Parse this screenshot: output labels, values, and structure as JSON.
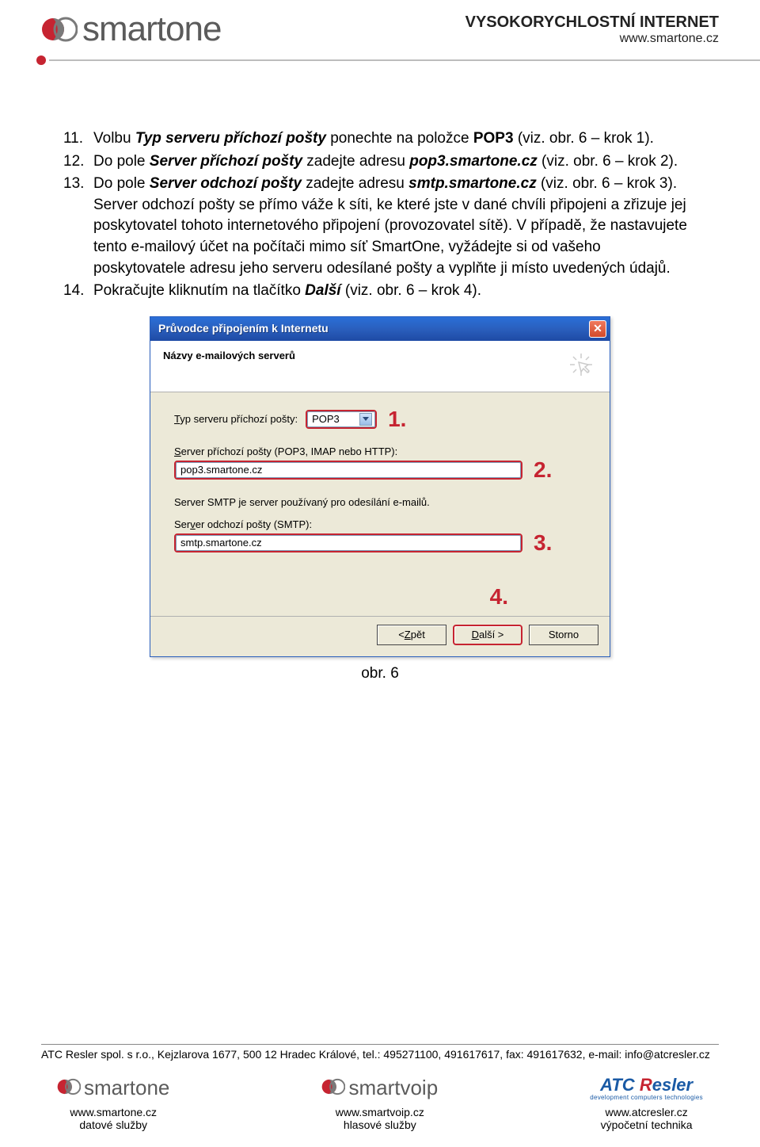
{
  "header": {
    "brand": "smartone",
    "right1": "VYSOKORYCHLOSTNÍ INTERNET",
    "right2": "www.smartone.cz"
  },
  "steps": [
    {
      "num": "11.",
      "parts": [
        {
          "t": "Volbu "
        },
        {
          "t": "Typ serveru příchozí pošty",
          "cls": "bi"
        },
        {
          "t": " ponechte na položce "
        },
        {
          "t": "POP3",
          "cls": "b"
        },
        {
          "t": " (viz. obr. 6 – krok 1)."
        }
      ]
    },
    {
      "num": "12.",
      "parts": [
        {
          "t": "Do pole "
        },
        {
          "t": "Server příchozí pošty",
          "cls": "bi"
        },
        {
          "t": " zadejte adresu "
        },
        {
          "t": "pop3.smartone.cz",
          "cls": "bi"
        },
        {
          "t": " (viz. obr. 6 – krok 2)."
        }
      ]
    },
    {
      "num": "13.",
      "parts": [
        {
          "t": "Do pole "
        },
        {
          "t": "Server odchozí pošty",
          "cls": "bi"
        },
        {
          "t": " zadejte adresu "
        },
        {
          "t": "smtp.smartone.cz",
          "cls": "bi"
        },
        {
          "t": " (viz. obr. 6 – krok 3). Server odchozí pošty se přímo váže k síti, ke které jste v dané chvíli připojeni a zřizuje jej poskytovatel tohoto internetového připojení (provozovatel sítě). V případě, že nastavujete tento e-mailový účet na počítači mimo síť SmartOne, vyžádejte si od vašeho poskytovatele adresu jeho serveru odesílané pošty a vyplňte ji místo uvedených údajů."
        }
      ]
    },
    {
      "num": "14.",
      "parts": [
        {
          "t": "Pokračujte kliknutím na tlačítko "
        },
        {
          "t": "Další",
          "cls": "bi"
        },
        {
          "t": " (viz. obr. 6 – krok 4)."
        }
      ]
    }
  ],
  "dialog": {
    "title": "Průvodce připojením k Internetu",
    "heading": "Názvy e-mailových serverů",
    "type_label_pre": "T",
    "type_label": "yp serveru příchozí pošty:",
    "type_value": "POP3",
    "m1": "1.",
    "incoming_label_pre": "S",
    "incoming_label": "erver příchozí pošty (POP3, IMAP nebo HTTP):",
    "incoming_value": "pop3.smartone.cz",
    "m2": "2.",
    "smtp_stmt": "Server SMTP je server používaný pro odesílání e-mailů.",
    "outgoing_label_pre": "Ser",
    "outgoing_label_u": "v",
    "outgoing_label_post": "er odchozí pošty (SMTP):",
    "outgoing_value": "smtp.smartone.cz",
    "m3": "3.",
    "m4": "4.",
    "btn_back_pre": "< ",
    "btn_back_u": "Z",
    "btn_back_post": "pět",
    "btn_next_u": "D",
    "btn_next_post": "alší >",
    "btn_cancel": "Storno"
  },
  "caption": "obr. 6",
  "footer": {
    "legal": "ATC Resler spol. s r.o., Kejzlarova 1677, 500 12  Hradec Králové, tel.: 495271100, 491617617, fax: 491617632, e-mail: info@atcresler.cz",
    "cols": [
      {
        "logo": "smartone",
        "url": "www.smartone.cz",
        "desc": "datové služby"
      },
      {
        "logo": "smartvoip",
        "url": "www.smartvoip.cz",
        "desc": "hlasové služby"
      },
      {
        "logo": "ATC Resler",
        "sub": "development computers technologies",
        "url": "www.atcresler.cz",
        "desc": "výpočetní technika"
      }
    ]
  }
}
